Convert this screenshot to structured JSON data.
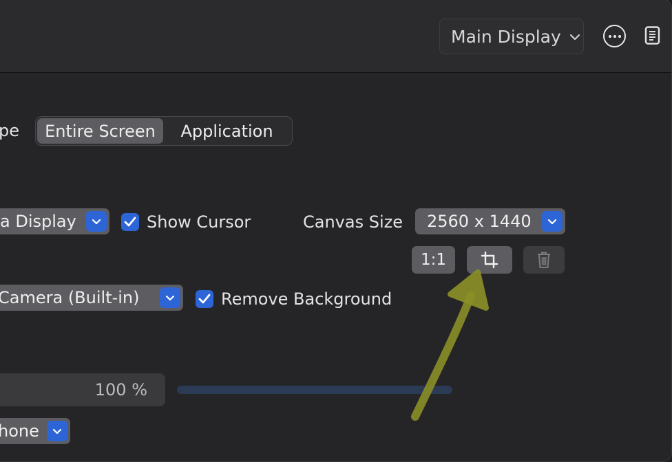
{
  "toolbar": {
    "display_select": "Main Display",
    "more_icon": "ellipsis-circle-icon",
    "doc_icon": "document-icon"
  },
  "capture": {
    "label_partial": "pe",
    "segments": [
      "Entire Screen",
      "Application"
    ],
    "selected": "Entire Screen"
  },
  "display_row": {
    "select_value": "a Display",
    "show_cursor": {
      "label": "Show Cursor",
      "checked": true
    },
    "canvas_label": "Canvas Size",
    "canvas_value": "2560 x 1440"
  },
  "canvas_buttons": {
    "ratio_label": "1:1",
    "crop_icon": "crop-icon",
    "trash_icon": "trash-icon"
  },
  "camera_row": {
    "select_value": "Camera (Built-in)",
    "remove_bg": {
      "label": "Remove Background",
      "checked": true
    }
  },
  "volume": {
    "value": "100 %"
  },
  "mic_row": {
    "select_value": "hone"
  },
  "colors": {
    "accent": "#2d64d6",
    "annotation": "#8a8f26"
  }
}
